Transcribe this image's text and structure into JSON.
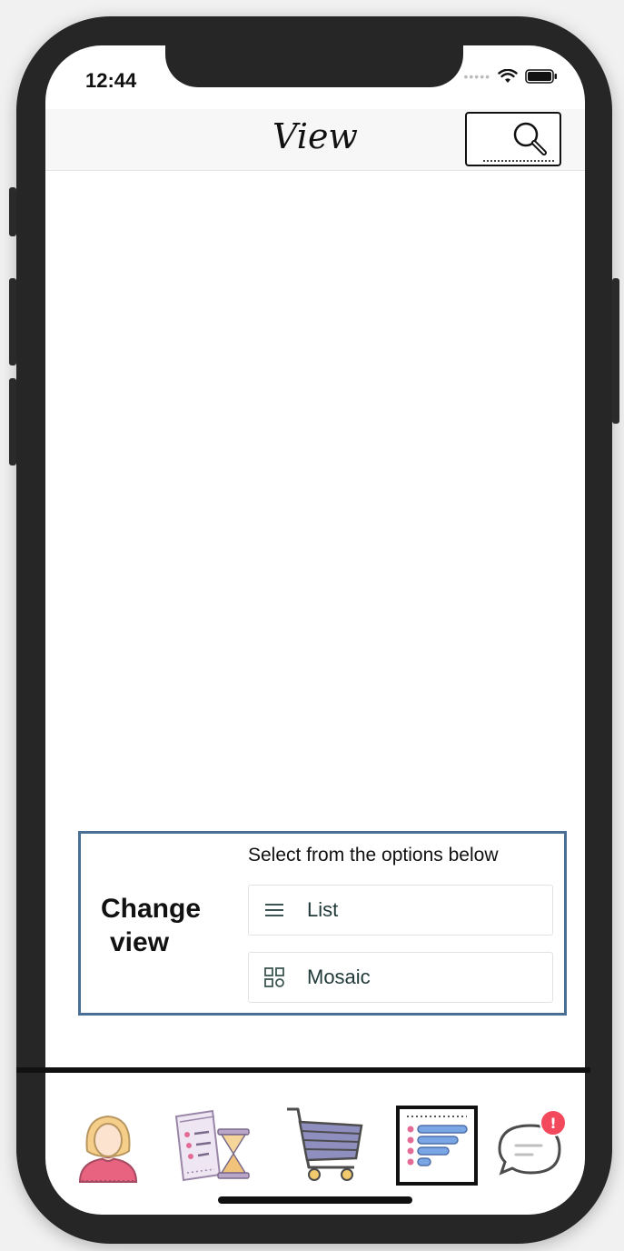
{
  "status_bar": {
    "time": "12:44"
  },
  "header": {
    "title": "View"
  },
  "change_view": {
    "label_line1": "Change",
    "label_line2": "view",
    "caption": "Select from the options below",
    "options": [
      {
        "label": "List",
        "icon": "list-lines-icon"
      },
      {
        "label": "Mosaic",
        "icon": "mosaic-grid-icon"
      }
    ]
  },
  "tabbar": {
    "tabs": [
      {
        "icon": "user-profile-icon"
      },
      {
        "icon": "order-history-icon"
      },
      {
        "icon": "shopping-cart-icon"
      },
      {
        "icon": "view-list-icon",
        "selected": true
      },
      {
        "icon": "chat-bubble-icon",
        "badge": "!"
      }
    ]
  },
  "colors": {
    "panel_border": "#4a6f95",
    "badge": "#f2495c",
    "accent_blue": "#7aa6e6",
    "accent_pink": "#e36c96"
  }
}
